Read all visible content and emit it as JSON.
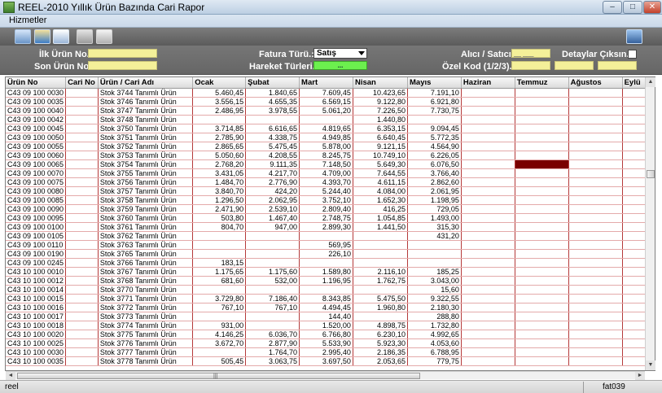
{
  "window": {
    "title": "REEL-2010 Yıllık Ürün Bazında Cari Rapor",
    "min": "–",
    "max": "□",
    "close": "✕"
  },
  "menu": {
    "items": [
      "Hizmetler"
    ]
  },
  "toolbar": {
    "icons": [
      "monitor-icon",
      "edit-report-icon",
      "pen-document-icon",
      "word-document-icon",
      "printer-icon",
      "chart-icon"
    ]
  },
  "filters": {
    "ilk_urun_label": "İlk Ürün No.:",
    "son_urun_label": "Son Ürün No.:",
    "fatura_turu_label": "Fatura Türü.:",
    "fatura_turu_value": "Satış",
    "hareket_label": "Hareket Türleri.:",
    "hareket_value": "...",
    "alici_label": "Alıcı / Satıcı.:",
    "alici_value": "__ ___",
    "ozel_kod_label": "Özel Kod (1/2/3).:",
    "detay_label": "Detaylar Çıksın..!"
  },
  "grid": {
    "columns": [
      "Ürün No",
      "Cari No",
      "Ürün / Cari Adı",
      "Ocak",
      "Şubat",
      "Mart",
      "Nisan",
      "Mayıs",
      "Haziran",
      "Temmuz",
      "Ağustos",
      "Eylü"
    ],
    "rows": [
      [
        "C43 09 100 0030",
        "",
        "Stok 3744 Tanımlı Ürün",
        "5.460,45",
        "1.840,65",
        "7.609,45",
        "10.423,65",
        "7.191,10",
        "",
        "",
        "",
        ""
      ],
      [
        "C43 09 100 0035",
        "",
        "Stok 3746 Tanımlı Ürün",
        "3.556,15",
        "4.655,35",
        "6.569,15",
        "9.122,80",
        "6.921,80",
        "",
        "",
        "",
        ""
      ],
      [
        "C43 09 100 0040",
        "",
        "Stok 3747 Tanımlı Ürün",
        "2.486,95",
        "3.978,55",
        "5.061,20",
        "7.226,50",
        "7.730,75",
        "",
        "",
        "",
        ""
      ],
      [
        "C43 09 100 0042",
        "",
        "Stok 3748 Tanımlı Ürün",
        "",
        "",
        "",
        "1.440,80",
        "",
        "",
        "",
        "",
        ""
      ],
      [
        "C43 09 100 0045",
        "",
        "Stok 3750 Tanımlı Ürün",
        "3.714,85",
        "6.616,65",
        "4.819,65",
        "6.353,15",
        "9.094,45",
        "",
        "",
        "",
        ""
      ],
      [
        "C43 09 100 0050",
        "",
        "Stok 3751 Tanımlı Ürün",
        "2.785,90",
        "4.338,75",
        "4.949,85",
        "6.640,45",
        "5.772,35",
        "",
        "",
        "",
        ""
      ],
      [
        "C43 09 100 0055",
        "",
        "Stok 3752 Tanımlı Ürün",
        "2.865,65",
        "5.475,45",
        "5.878,00",
        "9.121,15",
        "4.564,90",
        "",
        "",
        "",
        ""
      ],
      [
        "C43 09 100 0060",
        "",
        "Stok 3753 Tanımlı Ürün",
        "5.050,60",
        "4.208,55",
        "8.245,75",
        "10.749,10",
        "6.226,05",
        "",
        "",
        "",
        ""
      ],
      [
        "C43 09 100 0065",
        "",
        "Stok 3754 Tanımlı Ürün",
        "2.768,20",
        "9.111,35",
        "7.148,50",
        "5.649,30",
        "6.076,50",
        "",
        "",
        "",
        ""
      ],
      [
        "C43 09 100 0070",
        "",
        "Stok 3755 Tanımlı Ürün",
        "3.431,05",
        "4.217,70",
        "4.709,00",
        "7.644,55",
        "3.766,40",
        "",
        "",
        "",
        ""
      ],
      [
        "C43 09 100 0075",
        "",
        "Stok 3756 Tanımlı Ürün",
        "1.484,70",
        "2.776,90",
        "4.393,70",
        "4.611,15",
        "2.862,60",
        "",
        "",
        "",
        ""
      ],
      [
        "C43 09 100 0080",
        "",
        "Stok 3757 Tanımlı Ürün",
        "3.840,70",
        "424,20",
        "5.244,40",
        "4.084,00",
        "2.061,95",
        "",
        "",
        "",
        ""
      ],
      [
        "C43 09 100 0085",
        "",
        "Stok 3758 Tanımlı Ürün",
        "1.296,50",
        "2.062,95",
        "3.752,10",
        "1.652,30",
        "1.198,95",
        "",
        "",
        "",
        ""
      ],
      [
        "C43 09 100 0090",
        "",
        "Stok 3759 Tanımlı Ürün",
        "2.471,90",
        "2.539,10",
        "2.809,40",
        "416,25",
        "729,05",
        "",
        "",
        "",
        ""
      ],
      [
        "C43 09 100 0095",
        "",
        "Stok 3760 Tanımlı Ürün",
        "503,80",
        "1.467,40",
        "2.748,75",
        "1.054,85",
        "1.493,00",
        "",
        "",
        "",
        ""
      ],
      [
        "C43 09 100 0100",
        "",
        "Stok 3761 Tanımlı Ürün",
        "804,70",
        "947,00",
        "2.899,30",
        "1.441,50",
        "315,30",
        "",
        "",
        "",
        ""
      ],
      [
        "C43 09 100 0105",
        "",
        "Stok 3762 Tanımlı Ürün",
        "",
        "",
        "",
        "",
        "431,20",
        "",
        "",
        "",
        ""
      ],
      [
        "C43 09 100 0110",
        "",
        "Stok 3763 Tanımlı Ürün",
        "",
        "",
        "569,95",
        "",
        "",
        "",
        "",
        "",
        ""
      ],
      [
        "C43 09 100 0190",
        "",
        "Stok 3765 Tanımlı Ürün",
        "",
        "",
        "226,10",
        "",
        "",
        "",
        "",
        "",
        ""
      ],
      [
        "C43 09 100 0245",
        "",
        "Stok 3766 Tanımlı Ürün",
        "183,15",
        "",
        "",
        "",
        "",
        "",
        "",
        "",
        ""
      ],
      [
        "C43 10 100 0010",
        "",
        "Stok 3767 Tanımlı Ürün",
        "1.175,65",
        "1.175,60",
        "1.589,80",
        "2.116,10",
        "185,25",
        "",
        "",
        "",
        ""
      ],
      [
        "C43 10 100 0012",
        "",
        "Stok 3768 Tanımlı Ürün",
        "681,60",
        "532,00",
        "1.196,95",
        "1.762,75",
        "3.043,00",
        "",
        "",
        "",
        ""
      ],
      [
        "C43 10 100 0014",
        "",
        "Stok 3770 Tanımlı Ürün",
        "",
        "",
        "",
        "",
        "15,60",
        "",
        "",
        "",
        ""
      ],
      [
        "C43 10 100 0015",
        "",
        "Stok 3771 Tanımlı Ürün",
        "3.729,80",
        "7.186,40",
        "8.343,85",
        "5.475,50",
        "9.322,55",
        "",
        "",
        "",
        ""
      ],
      [
        "C43 10 100 0016",
        "",
        "Stok 3772 Tanımlı Ürün",
        "767,10",
        "767,10",
        "4.494,45",
        "1.960,80",
        "2.180,30",
        "",
        "",
        "",
        ""
      ],
      [
        "C43 10 100 0017",
        "",
        "Stok 3773 Tanımlı Ürün",
        "",
        "",
        "144,40",
        "",
        "288,80",
        "",
        "",
        "",
        ""
      ],
      [
        "C43 10 100 0018",
        "",
        "Stok 3774 Tanımlı Ürün",
        "931,00",
        "",
        "1.520,00",
        "4.898,75",
        "1.732,80",
        "",
        "",
        "",
        ""
      ],
      [
        "C43 10 100 0020",
        "",
        "Stok 3775 Tanımlı Ürün",
        "4.146,25",
        "6.036,70",
        "6.766,80",
        "6.230,10",
        "4.992,65",
        "",
        "",
        "",
        ""
      ],
      [
        "C43 10 100 0025",
        "",
        "Stok 3776 Tanımlı Ürün",
        "3.672,70",
        "2.877,90",
        "5.533,90",
        "5.923,30",
        "4.053,60",
        "",
        "",
        "",
        ""
      ],
      [
        "C43 10 100 0030",
        "",
        "Stok 3777 Tanımlı Ürün",
        "",
        "1.764,70",
        "2.995,40",
        "2.186,35",
        "6.788,95",
        "",
        "",
        "",
        ""
      ],
      [
        "C43 10 100 0035",
        "",
        "Stok 3778 Tanımlı Ürün",
        "505,45",
        "3.063,75",
        "3.697,50",
        "2.053,65",
        "779,75",
        "",
        "",
        "",
        ""
      ]
    ],
    "highlight": {
      "row": 8,
      "col": 9,
      "color": "#7a0000"
    }
  },
  "scrollbars": {
    "up": "▲",
    "down": "▼",
    "left": "◄",
    "right": "►",
    "grip": "|||"
  },
  "status": {
    "left": "reel",
    "right": "fat039"
  }
}
